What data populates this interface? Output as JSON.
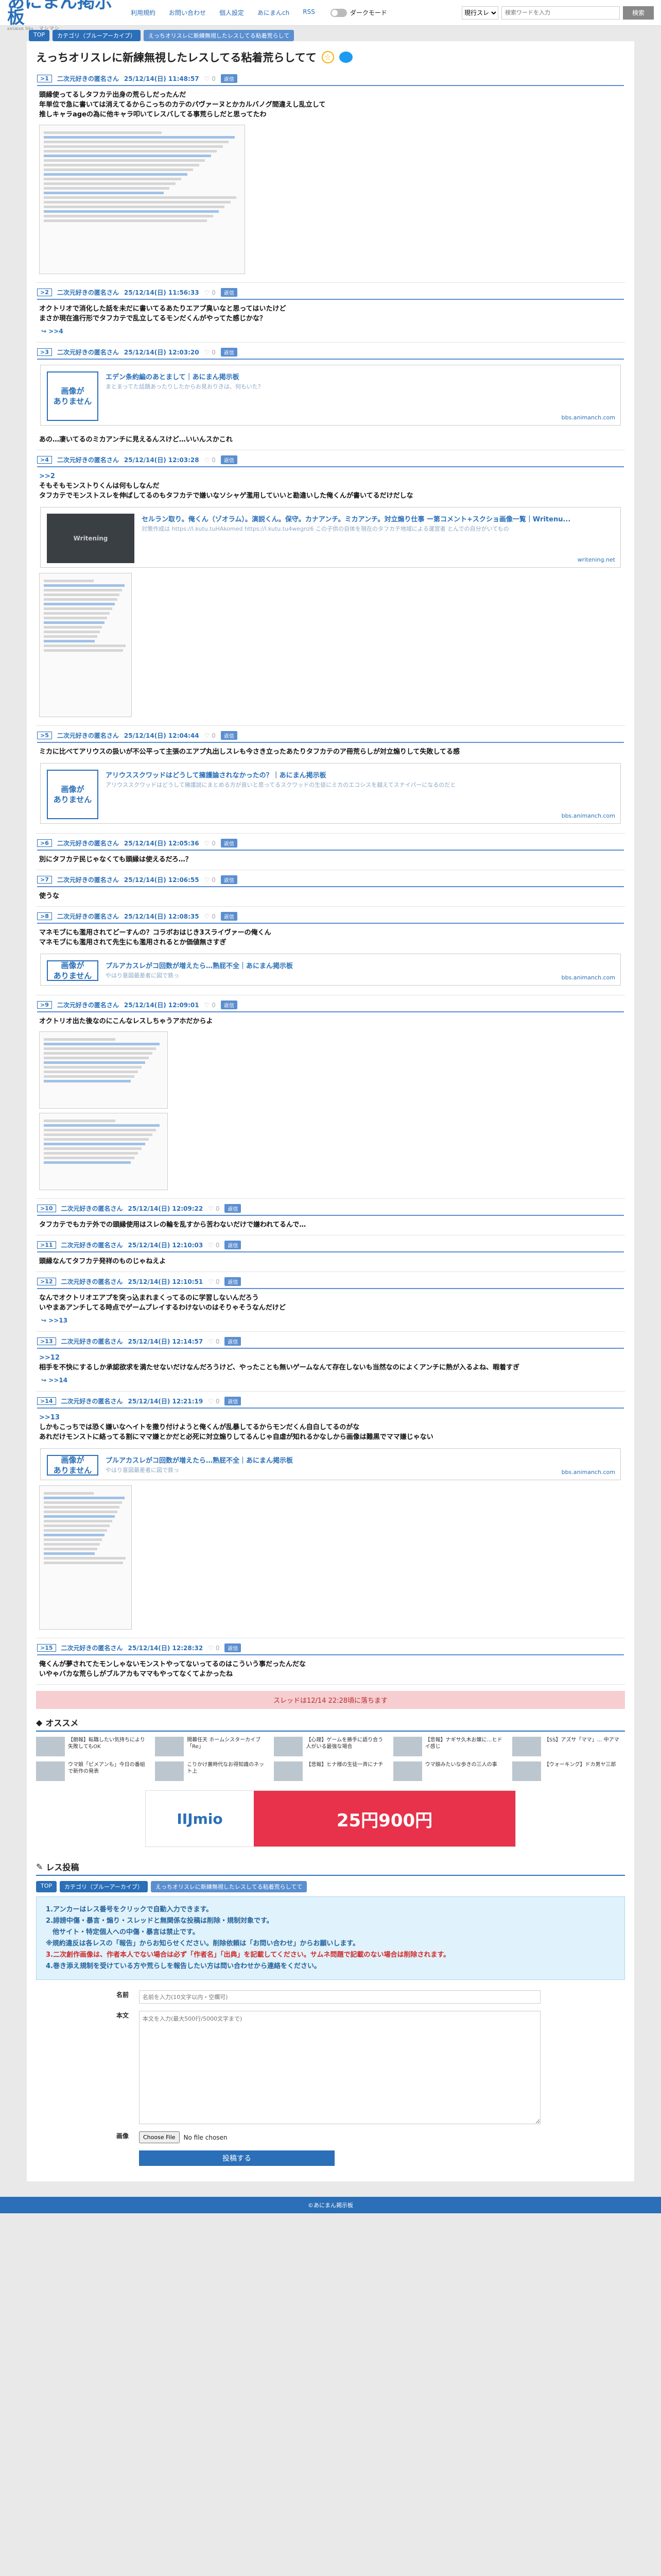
{
  "header": {
    "logo": "あにまん掲示板",
    "logo_sub": "animan bbs · マシマシ",
    "nav": [
      "利用規約",
      "お問い合わせ",
      "個人設定",
      "あにまんch",
      "RSS"
    ],
    "dark_mode": "ダークモード",
    "search_select": "現行スレ",
    "search_placeholder": "検索ワードを入力",
    "search_button": "検索"
  },
  "crumbs": [
    "TOP",
    "カテゴリ（ブルーアーカイブ）",
    "えっちオリスレに新練無視したレスしてる粘着荒らして"
  ],
  "thread_title": "えっちオリスレに新練無視したレスしてる粘着荒らしてて",
  "posts": [
    {
      "no": ">1",
      "name": "二次元好きの匿名さん",
      "date": "25/12/14(日) 11:48:57",
      "likes": "0",
      "reply": "返信",
      "lines": [
        "頭縁使ってるしタフカテ出身の荒らしだったんだ",
        "年単位で急に書いては消えてるからこっちのカテのパヴァーヌとかカルバノグ間違えし乱立して",
        "推しキャラageの為に他キャラ叩いてレスバしてる事荒らしだと思ってたわ"
      ]
    },
    {
      "no": ">2",
      "name": "二次元好きの匿名さん",
      "date": "25/12/14(日) 11:56:33",
      "likes": "0",
      "reply": "返信",
      "lines": [
        "オクトリオで消化した話を未だに書いてるあたりエアプ臭いなと思ってはいたけど",
        "まさか現在進行形でタフカテで乱立してるモンだくんがやってた感じかな？"
      ],
      "more": ">>4"
    },
    {
      "no": ">3",
      "name": "二次元好きの匿名さん",
      "date": "25/12/14(日) 12:03:20",
      "likes": "0",
      "reply": "返信",
      "card": {
        "img": "画像が\nありません",
        "title": "エデン条約編のあとまして｜あにまん掲示板",
        "desc": "まとまってた話題あったりしたからお見おりきは、何もいた？",
        "url": "bbs.animanch.com"
      },
      "lines": [
        "あの…凄いてるのミカアンチに見えるんスけど…いいんスかこれ"
      ]
    },
    {
      "no": ">4",
      "name": "二次元好きの匿名さん",
      "date": "25/12/14(日) 12:03:28",
      "likes": "0",
      "reply": "返信",
      "lines": [
        ">>2",
        "そもそもモンストりくんは何もしなんだ",
        "タフカテでモンストスレを伸ばしてるのもタフカテで嫌いなソシャゲ濫用していいと勘違いした俺くんが書いてるだけだしな"
      ],
      "card": {
        "img": "Writening",
        "title": "セルラン取り。俺くん（ゾオラム）。演説くん。保守。カナアンチ。ミカアンチ。対立煽り仕事 ー第コメント+スクショ画像一覧｜Writenu...",
        "desc": "対策作成は https://l.kutu.tuHAkomed https://l.kutu.tu4wegnz6 この子供の自体を現在のタフカテ地域による運営者 とんでの自分がいてもの",
        "url": "writening.net"
      }
    },
    {
      "no": ">5",
      "name": "二次元好きの匿名さん",
      "date": "25/12/14(日) 12:04:44",
      "likes": "0",
      "reply": "返信",
      "lines": [
        "ミカに比べてアリウスの扱いが不公平って主張のエアプ丸出しスレも今さき立ったあたりタフカテのア冊荒らしが対立煽りして失敗してる感"
      ],
      "card": {
        "img": "画像が\nありません",
        "title": "アリウススクワッドはどうして擁護論されなかったの？｜あにまん掲示板",
        "desc": "アリウススクワッドはどうして擁護説にまとめる方が良いと思ってるスクワッドの生徒にミカのエコシスを越えてスナイパーになるのだと",
        "url": "bbs.animanch.com"
      }
    },
    {
      "no": ">6",
      "name": "二次元好きの匿名さん",
      "date": "25/12/14(日) 12:05:36",
      "likes": "0",
      "reply": "返信",
      "lines": [
        "別にタフカテ民じゃなくても頭縁は使えるだろ…？"
      ]
    },
    {
      "no": ">7",
      "name": "二次元好きの匿名さん",
      "date": "25/12/14(日) 12:06:55",
      "likes": "0",
      "reply": "返信",
      "lines": [
        "使うな"
      ]
    },
    {
      "no": ">8",
      "name": "二次元好きの匿名さん",
      "date": "25/12/14(日) 12:08:35",
      "likes": "0",
      "reply": "返信",
      "lines": [
        "マネモブにも濫用されてどーすんの？コラボおはじき3スライヴァーの俺くん",
        "マネモブにも濫用されて先生にも濫用されるとか価値無さすぎ"
      ],
      "card": {
        "img": "画像が\nありません",
        "title": "プルアカスレがコ回数が増えたら…熟屁不全｜あにまん掲示板",
        "desc": "やはり意図最差者に図で鉄っ",
        "url": "bbs.animanch.com"
      }
    },
    {
      "no": ">9",
      "name": "二次元好きの匿名さん",
      "date": "25/12/14(日) 12:09:01",
      "likes": "0",
      "reply": "返信",
      "lines": [
        "オクトリオ出た後なのにこんなレスしちゃうアホだからよ"
      ]
    },
    {
      "no": ">10",
      "name": "二次元好きの匿名さん",
      "date": "25/12/14(日) 12:09:22",
      "likes": "0",
      "reply": "返信",
      "lines": [
        "タフカテでもカテ外での頭縁使用はスレの輪を乱すから苦わないだけで嫌われてるんで…"
      ]
    },
    {
      "no": ">11",
      "name": "二次元好きの匿名さん",
      "date": "25/12/14(日) 12:10:03",
      "likes": "0",
      "reply": "返信",
      "lines": [
        "頭縁なんてタフカテ発祥のものじゃねえよ"
      ]
    },
    {
      "no": ">12",
      "name": "二次元好きの匿名さん",
      "date": "25/12/14(日) 12:10:51",
      "likes": "0",
      "reply": "返信",
      "lines": [
        "なんでオクトリオエアプを突っ込まれまくってるのに学習しないんだろう",
        "いやまあアンチしてる時点でゲームプレイするわけないのはそりゃそうなんだけど"
      ],
      "more": ">>13"
    },
    {
      "no": ">13",
      "name": "二次元好きの匿名さん",
      "date": "25/12/14(日) 12:14:57",
      "likes": "0",
      "reply": "返信",
      "lines": [
        ">>12",
        "相手を不快にするしか承認欲求を満たせないだけなんだろうけど、やったことも無いゲームなんて存在しないも当然なのによくアンチに熱が入るよね、暇着すぎ"
      ],
      "more": ">>14"
    },
    {
      "no": ">14",
      "name": "二次元好きの匿名さん",
      "date": "25/12/14(日) 12:21:19",
      "likes": "0",
      "reply": "返信",
      "lines": [
        ">>13",
        "しかもこっちでは恐く嫌いなヘイトを撒り付けようと俺くんが乱暴してるからモンだくん自白してるのがな",
        "あれだけモンストに絡ってる割にママ嫌とかだと必死に対立煽りしてるんじゃ自虐が知れるかなしから画像は難黒でママ嫌じゃない"
      ],
      "card": {
        "img": "画像が\nありません",
        "title": "プルアカスレがコ回数が増えたら…熟屁不全｜あにまん掲示板",
        "desc": "やはり意図最差者に図で鉄っ",
        "url": "bbs.animanch.com"
      }
    },
    {
      "no": ">15",
      "name": "二次元好きの匿名さん",
      "date": "25/12/14(日) 12:28:32",
      "likes": "0",
      "reply": "返信",
      "lines": [
        "俺くんが夢されてたモンしゃないモンストやってないってるのはこういう事だったんだな",
        "いやゃバカな荒らしがブルアカもママもやってなくてよかったね"
      ]
    }
  ],
  "notice": "スレッドは12/14 22:28頃に落ちます",
  "recommend": {
    "title": "オススメ",
    "items": [
      "【朗報】転職したい気持ちにより失敗してもOK",
      "開幕任天 ホームシスターカイブ「Re」",
      "【心理】ゲームを勝手に語り合う人がいる最強な場合",
      "【悲報】ナギサ久木お嬢に…ヒドイ感じ",
      "【SS】アズサ「ママ」… 中アマ",
      "ウマ娘「ピメアンも」今日の番組で新作の発表",
      "こりかけ裏時代なお得知識のネット上",
      "【悲報】ヒナ様の生徒一斉にナチ",
      "ウマ娘みたいな歩きの三人の事",
      "【ウォーキング】ドカ男ヤ三郎"
    ]
  },
  "ad": {
    "brand": "IIJmio",
    "text": "25円900円"
  },
  "form_section": {
    "title": "レス投稿",
    "crumbs": [
      "TOP",
      "カテゴリ（ブルーアーカイブ）",
      "えっちオリスレに新練無視したレスしてる粘着荒らしてて"
    ],
    "rules": [
      "1.アンカーはレス番号をクリックで自動入力できます。",
      "2.誹謗中傷・暴言・煽り・スレッドと無関係な投稿は削除・規制対象です。",
      "　他サイト・特定個人への中傷・暴言は禁止です。",
      "※規約違反は各レスの「報告」からお知らせください。削除依頼は「お問い合わせ」からお願いします。",
      "3.二次創作画像は、作者本人でない場合は必ず「作者名」「出典」を記載してください。サムネ問題で記載のない場合は削除されます。",
      "4.巻き添え規制を受けている方や荒らしを報告したい方は問い合わせから連絡をください。"
    ],
    "name_label": "名前",
    "name_placeholder": "名前を入力(10文字以内・空欄可)",
    "body_label": "本文",
    "body_placeholder": "本文を入力(最大500行/5000文字まで)",
    "image_label": "画像",
    "choose_file": "Choose File",
    "no_file": "No file chosen",
    "submit": "投稿する"
  },
  "footer": "©あにまん掲示板"
}
